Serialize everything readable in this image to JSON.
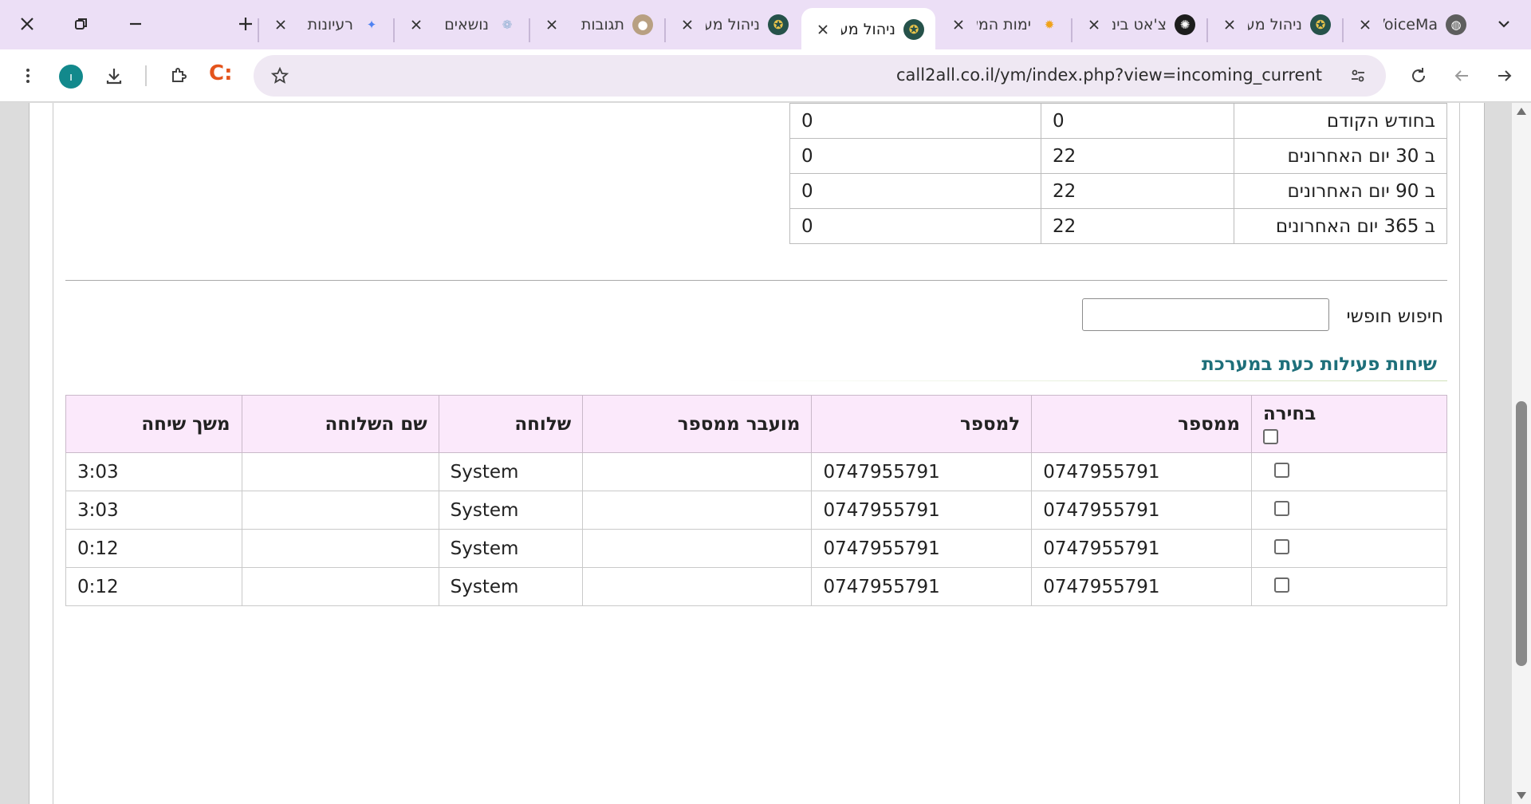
{
  "browser": {
    "tabs": [
      {
        "title": "VoiceMa",
        "icon": "globe-icon",
        "active": false
      },
      {
        "title": "ניהול מע",
        "icon": "shield-logo-icon",
        "active": false
      },
      {
        "title": "צ'אט בינ",
        "icon": "openai-logo-icon",
        "active": false
      },
      {
        "title": "ימות המש",
        "icon": "sun-logo-icon",
        "active": false
      },
      {
        "title": "ניהול מע",
        "icon": "shield-logo-icon",
        "active": true
      },
      {
        "title": "ניהול מע",
        "icon": "shield-logo-icon",
        "active": false
      },
      {
        "title": "תגובות",
        "icon": "orb-icon",
        "active": false
      },
      {
        "title": "נושאים",
        "icon": "gear-logo-icon",
        "active": false
      },
      {
        "title": "רעיונות",
        "icon": "sparkle-icon",
        "active": false
      }
    ],
    "url": "call2all.co.il/ym/index.php?view=incoming_current",
    "profile_initial": "ו",
    "extension_label": "C:"
  },
  "stats": {
    "rows": [
      {
        "label": "בחודש הקודם",
        "a": "0",
        "b": "0"
      },
      {
        "label": "ב 30 יום האחרונים",
        "a": "22",
        "b": "0"
      },
      {
        "label": "ב 90 יום האחרונים",
        "a": "22",
        "b": "0"
      },
      {
        "label": "ב 365 יום האחרונים",
        "a": "22",
        "b": "0"
      }
    ]
  },
  "search": {
    "label": "חיפוש חופשי",
    "value": ""
  },
  "calls": {
    "title": "שיחות פעילות כעת במערכת",
    "columns": [
      "בחירה",
      "ממספר",
      "למספר",
      "מועבר ממספר",
      "שלוחה",
      "שם השלוחה",
      "משך שיחה"
    ],
    "rows": [
      {
        "from": "0747955791",
        "to": "0747955791",
        "forwarded": "",
        "extension": "System",
        "extension_name": "",
        "duration": "3:03"
      },
      {
        "from": "0747955791",
        "to": "0747955791",
        "forwarded": "",
        "extension": "System",
        "extension_name": "",
        "duration": "3:03"
      },
      {
        "from": "0747955791",
        "to": "0747955791",
        "forwarded": "",
        "extension": "System",
        "extension_name": "",
        "duration": "0:12"
      },
      {
        "from": "0747955791",
        "to": "0747955791",
        "forwarded": "",
        "extension": "System",
        "extension_name": "",
        "duration": "0:12"
      }
    ]
  },
  "colors": {
    "tab_strip": "#ecdff6",
    "header_row": "#fbe9fb",
    "section_title": "#1e6f7a"
  }
}
